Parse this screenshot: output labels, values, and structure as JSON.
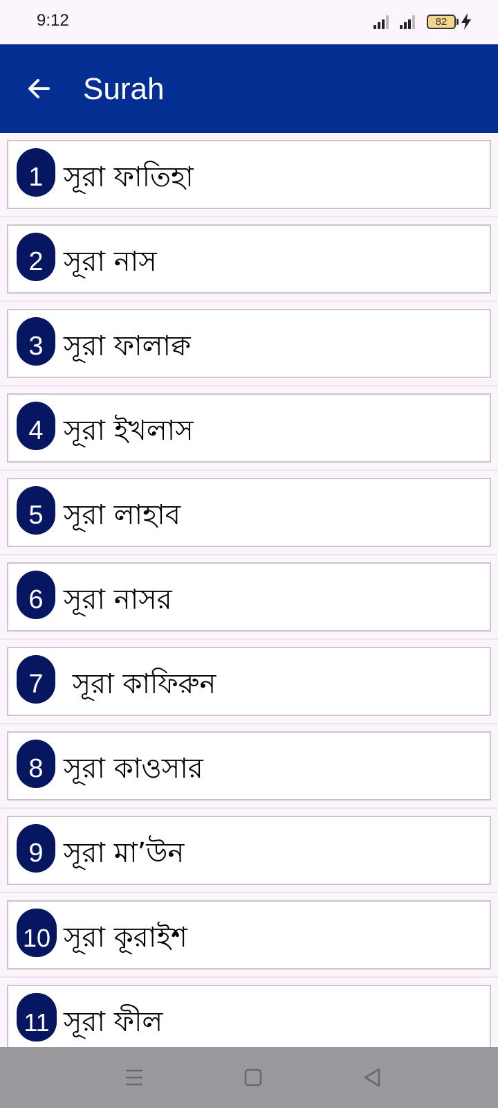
{
  "status_bar": {
    "time": "9:12",
    "battery": "82"
  },
  "app_bar": {
    "title": "Surah",
    "background": "#052e92"
  },
  "surahs": [
    {
      "number": "1",
      "name": "সূরা ফাতিহা"
    },
    {
      "number": "2",
      "name": "সূরা নাস"
    },
    {
      "number": "3",
      "name": "সূরা ফালাক্ব"
    },
    {
      "number": "4",
      "name": "সূরা ইখলাস"
    },
    {
      "number": "5",
      "name": "সূরা লাহাব"
    },
    {
      "number": "6",
      "name": "সূরা নাসর"
    },
    {
      "number": "7",
      "name": " সূরা কাফিরুন"
    },
    {
      "number": "8",
      "name": "সূরা কাওসার"
    },
    {
      "number": "9",
      "name": "সূরা মা’উন"
    },
    {
      "number": "10",
      "name": "সূরা কূরাইশ"
    },
    {
      "number": "11",
      "name": "সূরা ফীল"
    }
  ],
  "colors": {
    "badge": "#061660",
    "nav_bar": "#9b989d"
  },
  "nav_icons": [
    "menu-icon",
    "home-icon",
    "back-triangle-icon"
  ]
}
